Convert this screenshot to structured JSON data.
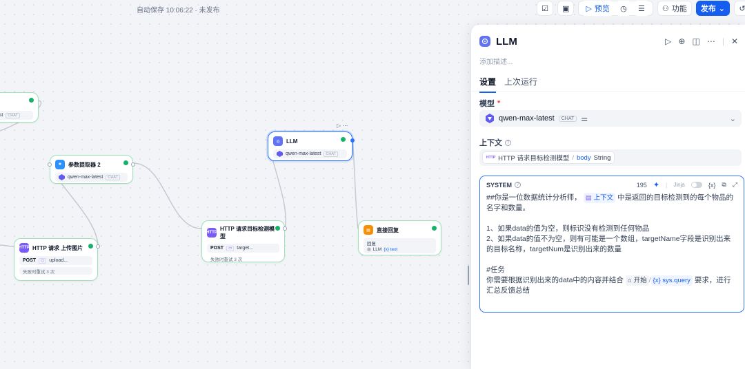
{
  "autosave": "自动保存 10:06:22 · 未发布",
  "toolbar": {
    "preview": "预览",
    "features": "功能",
    "publish": "发布"
  },
  "nodes": {
    "left_partial": {
      "model_suffix": "test",
      "chip": "CHAT"
    },
    "param_extractor": {
      "title": "参数提取器 2",
      "model": "qwen-max-latest",
      "chip": "CHAT"
    },
    "llm": {
      "title": "LLM",
      "model": "qwen-max-latest",
      "chip": "CHAT"
    },
    "http_upload": {
      "title": "HTTP 请求 上传图片",
      "method": "POST",
      "url": "upload...",
      "retry": "失败时重试 3 次"
    },
    "http_detect": {
      "title": "HTTP 请求目标检测模型",
      "method": "POST",
      "url": "target...",
      "retry": "失败时重试 3 次"
    },
    "answer": {
      "title": "直接回复",
      "label": "回复",
      "source": "LLM",
      "var": "{x} text"
    }
  },
  "panel": {
    "title": "LLM",
    "description_placeholder": "添加描述...",
    "tabs": [
      "设置",
      "上次运行"
    ],
    "model_label": "模型",
    "model_name": "qwen-max-latest",
    "model_chip": "CHAT",
    "context_label": "上下文",
    "context_node": "HTTP 请求目标检测模型",
    "context_sep": "/",
    "context_var": "body",
    "context_type": "String",
    "system": {
      "label": "SYSTEM",
      "count": "195",
      "jinja": "Jinja",
      "var_btn": "{x}",
      "line1_a": "##你是一位数据统计分析师，",
      "line1_chip": "上下文",
      "line1_b": "中是返回的目标检测到的每个物品的名字和数量。",
      "line2": "",
      "line3": "1、如果data的值为空，则标识没有检测到任何物品",
      "line4": "2、如果data的值不为空，则有可能是一个数组，targetName字段是识别出来的目标名称，targetNum是识别出来的数量",
      "line5": "",
      "line6": "#任务",
      "line7_a": "你需要根据识别出来的data中的内容并结合",
      "line7_node": "开始",
      "line7_var": "{x} sys.query",
      "line7_b": "要求，进行汇总反馈总结"
    }
  },
  "colors": {
    "accent": "#155eef",
    "success": "#17b26a",
    "node_border": "#9ee2b8"
  }
}
